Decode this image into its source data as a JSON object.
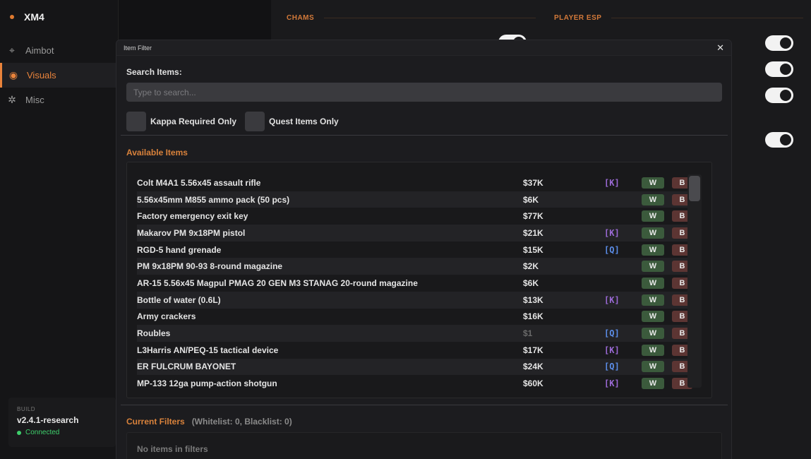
{
  "app": {
    "title": "XM4"
  },
  "sidebar": {
    "items": [
      {
        "label": "Aimbot",
        "icon": "crosshair-icon",
        "active": false
      },
      {
        "label": "Visuals",
        "icon": "eye-icon",
        "active": true
      },
      {
        "label": "Misc",
        "icon": "gear-icon",
        "active": false
      }
    ],
    "build": {
      "label": "BUILD",
      "version": "v2.4.1-research",
      "status": "Connected"
    }
  },
  "main": {
    "sections": [
      "CHAMS",
      "PLAYER ESP"
    ]
  },
  "modal": {
    "title": "Item Filter",
    "close": "✕",
    "search_label": "Search Items:",
    "search_placeholder": "Type to search...",
    "checkboxes": [
      "Kappa Required Only",
      "Quest Items Only"
    ],
    "available_title": "Available Items",
    "buttons": {
      "whitelist": "W",
      "blacklist": "B"
    },
    "items": [
      {
        "name": "Colt M4A1 5.56x45 assault rifle",
        "price": "$37K",
        "tag": "[K]"
      },
      {
        "name": "5.56x45mm M855 ammo pack (50 pcs)",
        "price": "$6K",
        "tag": ""
      },
      {
        "name": "Factory emergency exit key",
        "price": "$77K",
        "tag": ""
      },
      {
        "name": "Makarov PM 9x18PM pistol",
        "price": "$21K",
        "tag": "[K]"
      },
      {
        "name": "RGD-5 hand grenade",
        "price": "$15K",
        "tag": "[Q]"
      },
      {
        "name": "PM 9x18PM 90-93 8-round magazine",
        "price": "$2K",
        "tag": ""
      },
      {
        "name": "AR-15 5.56x45 Magpul PMAG 20 GEN M3 STANAG 20-round magazine",
        "price": "$6K",
        "tag": ""
      },
      {
        "name": "Bottle of water (0.6L)",
        "price": "$13K",
        "tag": "[K]"
      },
      {
        "name": "Army crackers",
        "price": "$16K",
        "tag": ""
      },
      {
        "name": "Roubles",
        "price": "$1",
        "tag": "[Q]"
      },
      {
        "name": "L3Harris AN/PEQ-15 tactical device",
        "price": "$17K",
        "tag": "[K]"
      },
      {
        "name": "ER FULCRUM BAYONET",
        "price": "$24K",
        "tag": "[Q]"
      },
      {
        "name": "MP-133 12ga pump-action shotgun",
        "price": "$60K",
        "tag": "[K]"
      }
    ],
    "current_filters": {
      "title": "Current Filters",
      "counts": "(Whitelist: 0, Blacklist: 0)",
      "empty": "No items in filters"
    }
  },
  "colors": {
    "accent": "#e9833b",
    "kappa": "#9b6ad6",
    "quest": "#5b8de8",
    "whitelist": "#3b5a3c",
    "blacklist": "#5c3533",
    "connected": "#3ecf6b"
  }
}
